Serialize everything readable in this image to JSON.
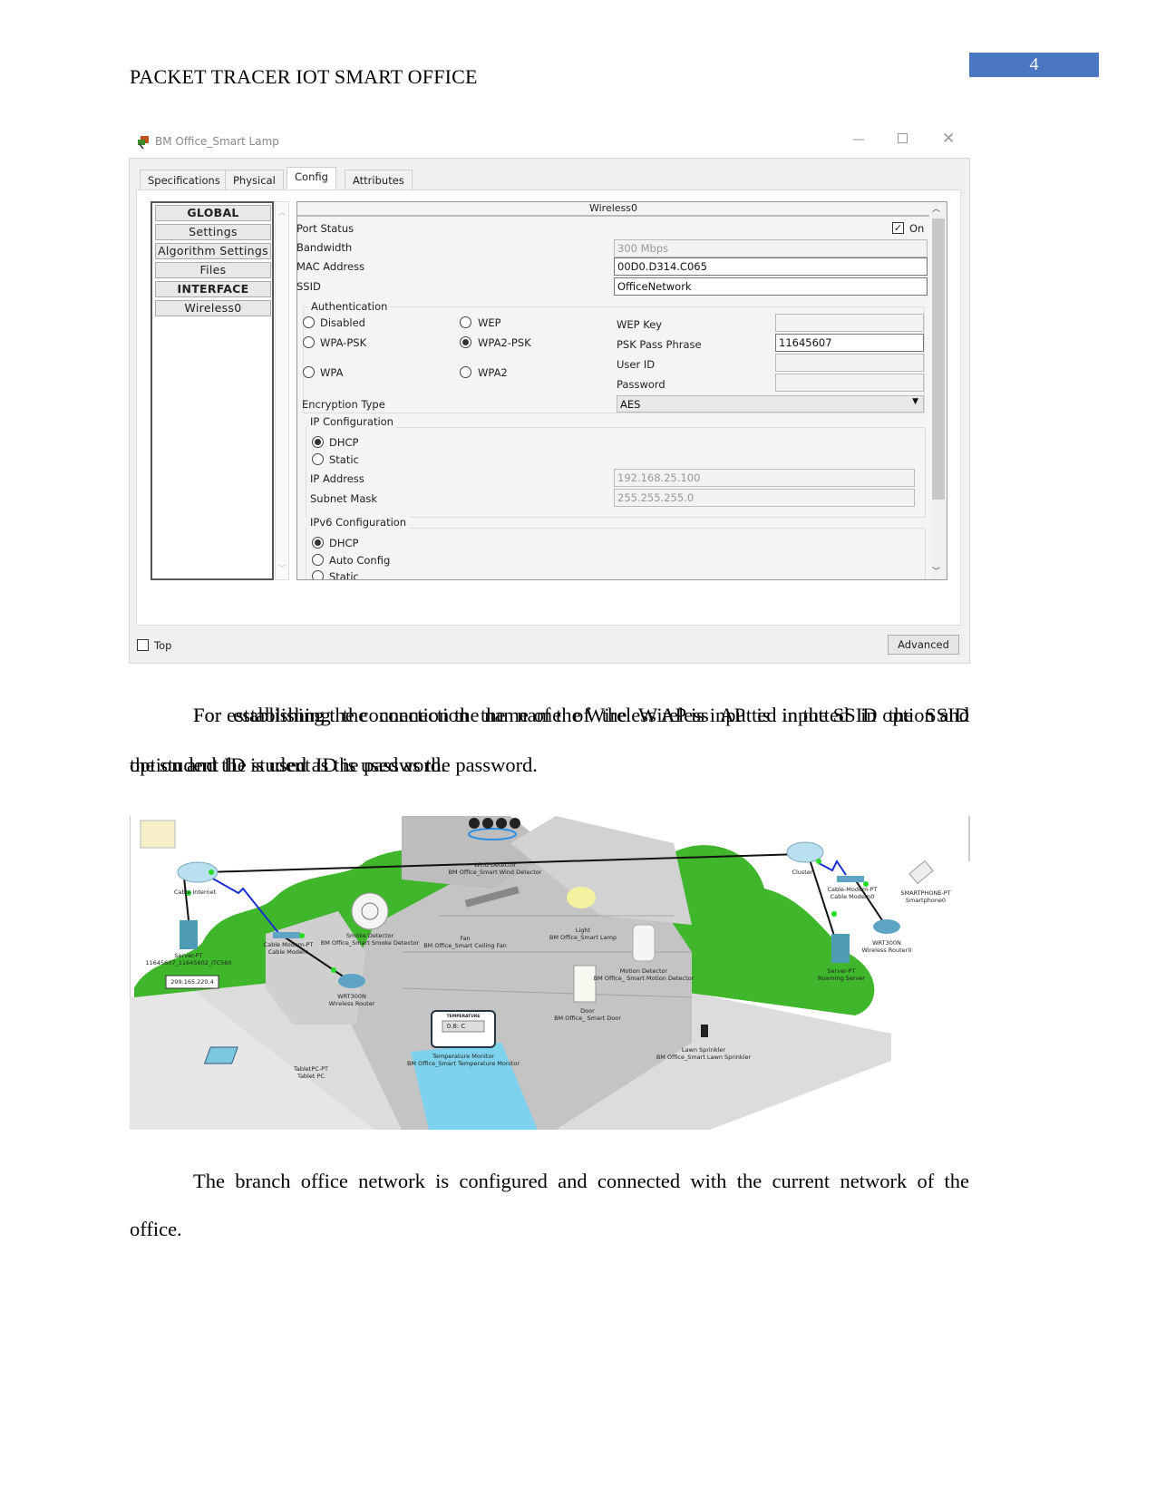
{
  "page": {
    "header": "PACKET TRACER IOT SMART OFFICE",
    "page_number": "4",
    "accent": "#4a76c4"
  },
  "dialog": {
    "title": "BM Office_Smart Lamp",
    "tabs": [
      "Specifications",
      "Physical",
      "Config",
      "Attributes"
    ],
    "active_tab": "Config",
    "sidebar": [
      {
        "label": "GLOBAL",
        "header": true
      },
      {
        "label": "Settings"
      },
      {
        "label": "Algorithm Settings"
      },
      {
        "label": "Files"
      },
      {
        "label": "INTERFACE",
        "header": true
      },
      {
        "label": "Wireless0"
      }
    ],
    "panel_title": "Wireless0",
    "port_status_label": "Port Status",
    "port_on_label": "On",
    "port_on": true,
    "bandwidth_label": "Bandwidth",
    "bandwidth": "300 Mbps",
    "mac_label": "MAC Address",
    "mac": "00D0.D314.C065",
    "ssid_label": "SSID",
    "ssid": "OfficeNetwork",
    "auth": {
      "title": "Authentication",
      "options": [
        "Disabled",
        "WEP",
        "WPA-PSK",
        "WPA2-PSK",
        "WPA",
        "WPA2"
      ],
      "selected": "WPA2-PSK",
      "wep_key_label": "WEP Key",
      "wep_key": "",
      "psk_label": "PSK Pass Phrase",
      "psk": "11645607",
      "user_id_label": "User ID",
      "user_id": "",
      "password_label": "Password",
      "password": ""
    },
    "encryption_label": "Encryption Type",
    "encryption": "AES",
    "ip": {
      "title": "IP Configuration",
      "dhcp": "DHCP",
      "static": "Static",
      "selected": "DHCP",
      "ip_label": "IP Address",
      "ip": "192.168.25.100",
      "mask_label": "Subnet Mask",
      "mask": "255.255.255.0"
    },
    "ipv6": {
      "title": "IPv6 Configuration",
      "dhcp": "DHCP",
      "auto": "Auto Config",
      "static": "Static",
      "selected": "DHCP"
    },
    "top_label": "Top",
    "advanced_label": "Advanced"
  },
  "para1": "For establishing the connection the name of the Wireless AP is inputted in the SSID option and the student ID is used as the password.",
  "para1a": "For establishing the connection the name of the Wireless AP is inputted in the SSID",
  "para1b": "option and the student ID is used as the password.",
  "para2a": "The branch office network is configured and connected with the current network of the",
  "para2b": "office.",
  "network": {
    "labels": [
      {
        "id": "cable-internet",
        "text": "Cable Internet"
      },
      {
        "id": "server",
        "text": "Server-PT\n11645607_11645602_ITC560"
      },
      {
        "id": "ip",
        "text": "209.165.220.4"
      },
      {
        "id": "cable-modem",
        "text": "Cable Modem-PT\nCable Modem"
      },
      {
        "id": "router",
        "text": "WRT300N\nWireless Router"
      },
      {
        "id": "smoke",
        "text": "Smoke Detector\nBM Office_Smart Smoke Detector"
      },
      {
        "id": "fan",
        "text": "Fan\nBM Office_Smart Ceiling Fan"
      },
      {
        "id": "wind",
        "text": "Wind Detector\nBM Office_Smart Wind Detector"
      },
      {
        "id": "lamp",
        "text": "Light\nBM Office_Smart Lamp"
      },
      {
        "id": "motion",
        "text": "Motion Detector\nBM Office_ Smart Motion Detector"
      },
      {
        "id": "door",
        "text": "Door\nBM Office_ Smart Door"
      },
      {
        "id": "temp",
        "text": "Temperature Monitor\nBM Office_Smart Temperature Monitor"
      },
      {
        "id": "sprinkler",
        "text": "Lawn Sprinkler\nBM Office_Smart Lawn Sprinkler"
      },
      {
        "id": "tablet",
        "text": "TabletPC-PT\nTablet PC"
      },
      {
        "id": "cluster",
        "text": "Cluster"
      },
      {
        "id": "cable-modem0",
        "text": "Cable-Modem-PT\nCable Modem0"
      },
      {
        "id": "router0",
        "text": "WRT300N\nWireless Router0"
      },
      {
        "id": "roaming",
        "text": "Server-PT\nRoaming Server"
      },
      {
        "id": "phone",
        "text": "SMARTPHONE-PT\nSmartphone0"
      }
    ],
    "temp_title": "TEMPERATURE",
    "temp_value": "0.8: C"
  }
}
